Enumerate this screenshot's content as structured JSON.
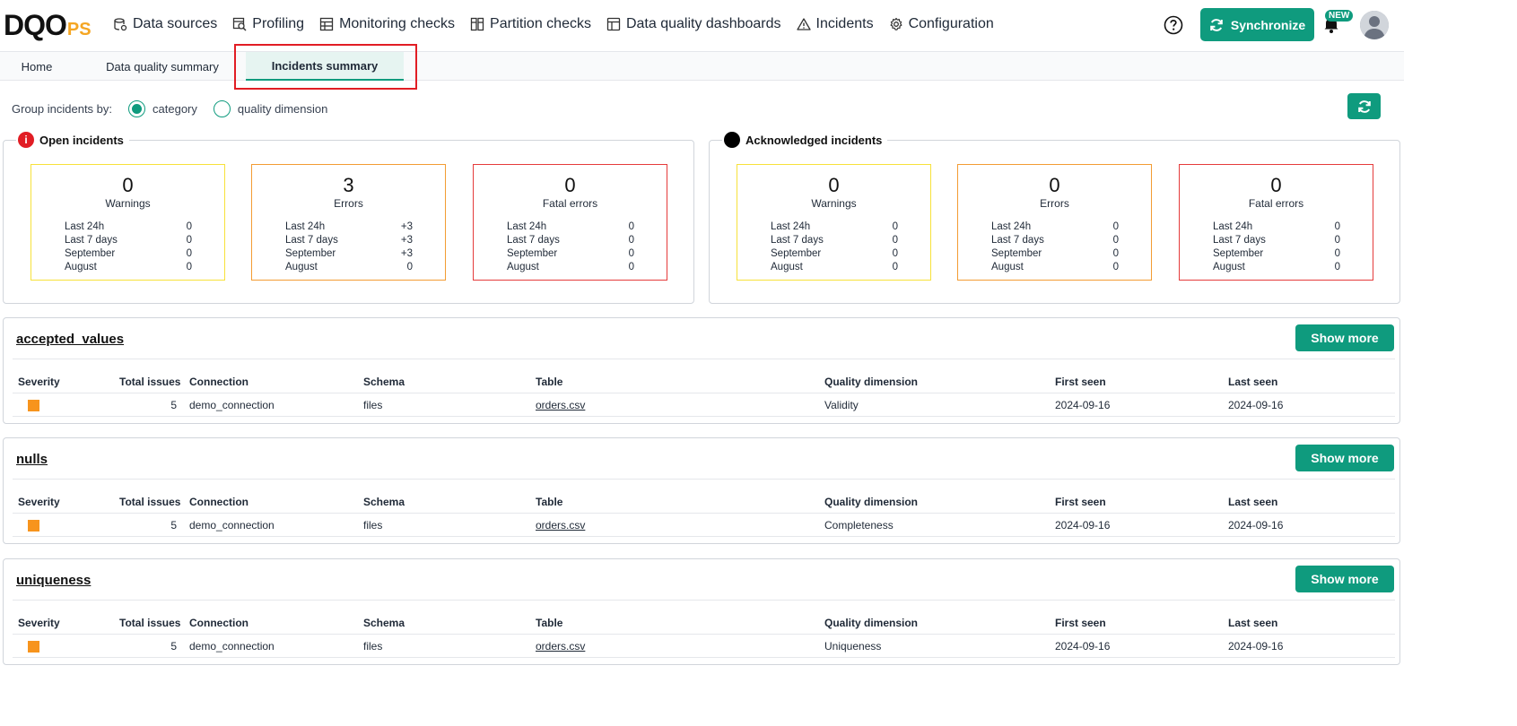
{
  "brand": {
    "logo_main": "DQO",
    "logo_suffix": "PS",
    "accent": "#0f9b7e"
  },
  "nav": [
    {
      "label": "Data sources",
      "icon": "database-icon"
    },
    {
      "label": "Profiling",
      "icon": "profiling-icon"
    },
    {
      "label": "Monitoring checks",
      "icon": "table-check-icon"
    },
    {
      "label": "Partition checks",
      "icon": "partition-icon"
    },
    {
      "label": "Data quality dashboards",
      "icon": "dashboard-icon"
    },
    {
      "label": "Incidents",
      "icon": "warning-icon"
    },
    {
      "label": "Configuration",
      "icon": "gear-icon"
    }
  ],
  "header": {
    "sync_label": "Synchronize",
    "new_badge": "NEW"
  },
  "tabs": [
    {
      "label": "Home"
    },
    {
      "label": "Data quality summary"
    },
    {
      "label": "Incidents summary",
      "active": true
    }
  ],
  "group": {
    "label": "Group incidents by:",
    "opt1": "category",
    "opt2": "quality dimension"
  },
  "open": {
    "title": "Open incidents",
    "cards": [
      {
        "num": "0",
        "label": "Warnings",
        "rows": [
          [
            "Last 24h",
            "0"
          ],
          [
            "Last 7 days",
            "0"
          ],
          [
            "September",
            "0"
          ],
          [
            "August",
            "0"
          ]
        ]
      },
      {
        "num": "3",
        "label": "Errors",
        "rows": [
          [
            "Last 24h",
            "+3"
          ],
          [
            "Last 7 days",
            "+3"
          ],
          [
            "September",
            "+3"
          ],
          [
            "August",
            "0"
          ]
        ]
      },
      {
        "num": "0",
        "label": "Fatal errors",
        "rows": [
          [
            "Last 24h",
            "0"
          ],
          [
            "Last 7 days",
            "0"
          ],
          [
            "September",
            "0"
          ],
          [
            "August",
            "0"
          ]
        ]
      }
    ]
  },
  "ack": {
    "title": "Acknowledged incidents",
    "cards": [
      {
        "num": "0",
        "label": "Warnings",
        "rows": [
          [
            "Last 24h",
            "0"
          ],
          [
            "Last 7 days",
            "0"
          ],
          [
            "September",
            "0"
          ],
          [
            "August",
            "0"
          ]
        ]
      },
      {
        "num": "0",
        "label": "Errors",
        "rows": [
          [
            "Last 24h",
            "0"
          ],
          [
            "Last 7 days",
            "0"
          ],
          [
            "September",
            "0"
          ],
          [
            "August",
            "0"
          ]
        ]
      },
      {
        "num": "0",
        "label": "Fatal errors",
        "rows": [
          [
            "Last 24h",
            "0"
          ],
          [
            "Last 7 days",
            "0"
          ],
          [
            "September",
            "0"
          ],
          [
            "August",
            "0"
          ]
        ]
      }
    ]
  },
  "columns": [
    "Severity",
    "Total issues",
    "Connection",
    "Schema",
    "Table",
    "Quality dimension",
    "First seen",
    "Last seen"
  ],
  "show_more_label": "Show more",
  "sections": [
    {
      "title": "accepted_values",
      "row": {
        "total": "5",
        "connection": "demo_connection",
        "schema": "files",
        "table": "orders.csv",
        "dimension": "Validity",
        "first": "2024-09-16",
        "last": "2024-09-16"
      }
    },
    {
      "title": "nulls",
      "row": {
        "total": "5",
        "connection": "demo_connection",
        "schema": "files",
        "table": "orders.csv",
        "dimension": "Completeness",
        "first": "2024-09-16",
        "last": "2024-09-16"
      }
    },
    {
      "title": "uniqueness",
      "row": {
        "total": "5",
        "connection": "demo_connection",
        "schema": "files",
        "table": "orders.csv",
        "dimension": "Uniqueness",
        "first": "2024-09-16",
        "last": "2024-09-16"
      }
    }
  ]
}
